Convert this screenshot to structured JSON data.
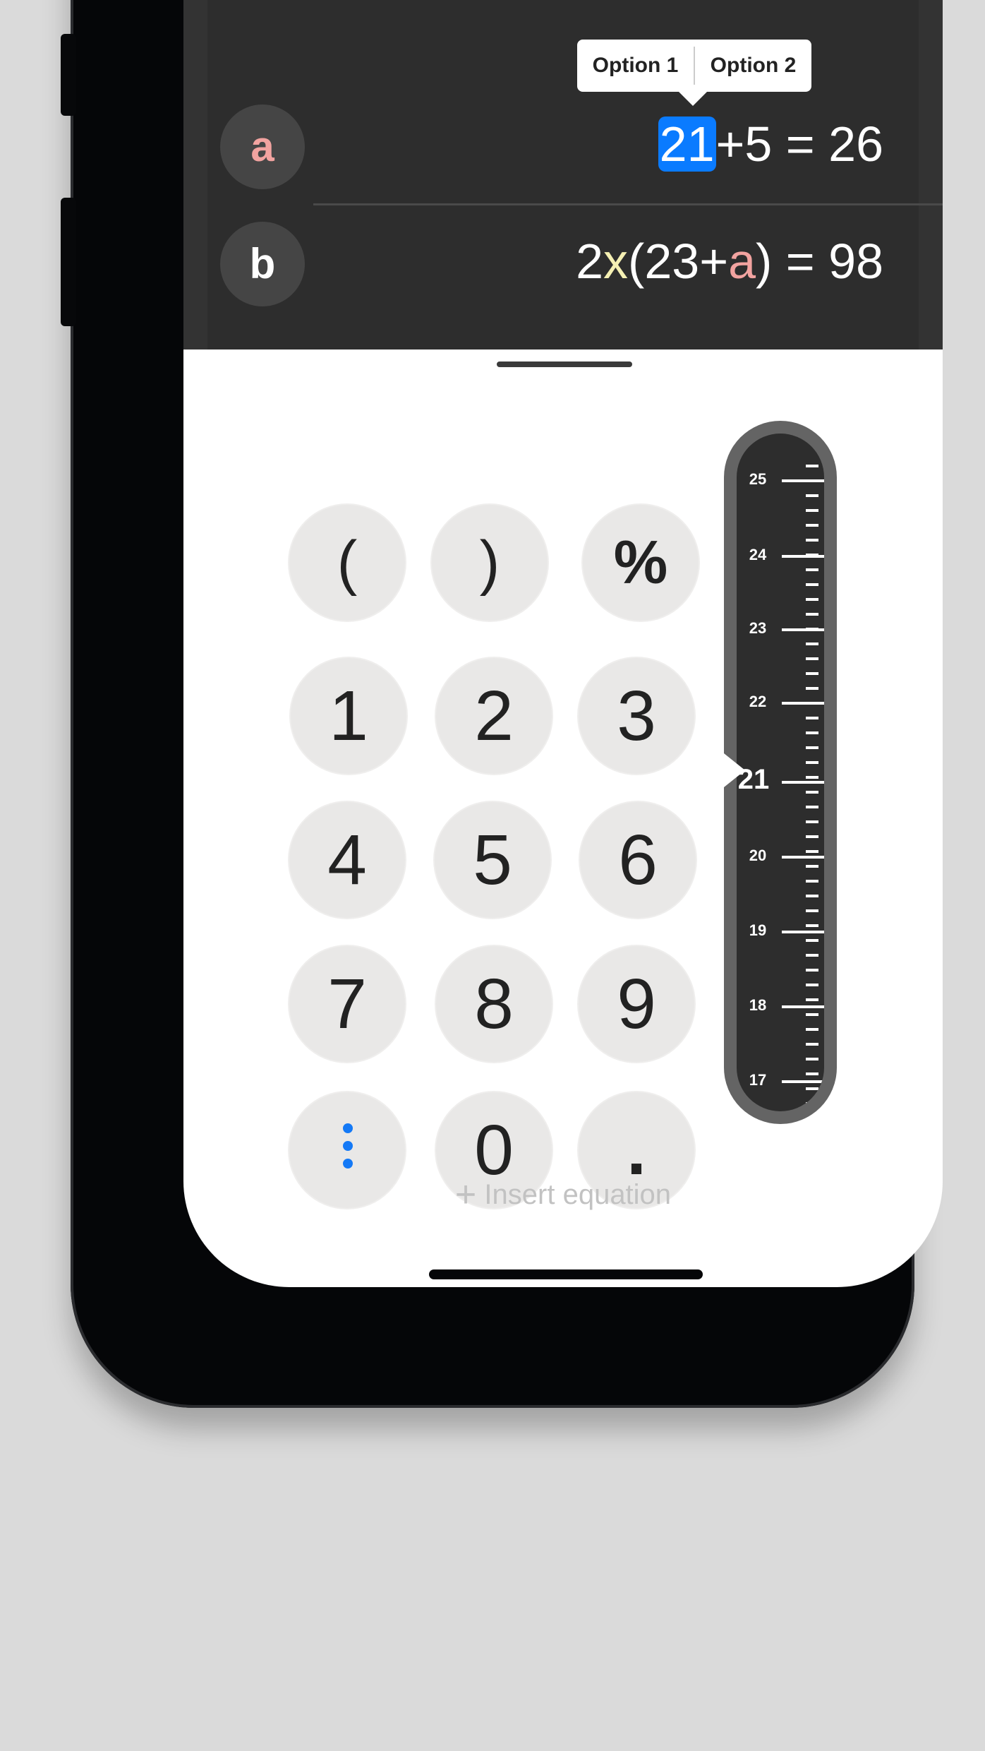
{
  "equations": [
    {
      "variable": "a",
      "variable_color": "#f2a3a0",
      "selected_token": "21",
      "rest": "+5 = 26"
    },
    {
      "variable": "b",
      "parts": {
        "p1": "2",
        "x": "x",
        "p2": "(23+",
        "a": "a",
        "p3": ") = 98"
      }
    }
  ],
  "popup": {
    "option1": "Option 1",
    "option2": "Option 2"
  },
  "keypad": {
    "row0": [
      "(",
      ")",
      "%"
    ],
    "row1": [
      "1",
      "2",
      "3"
    ],
    "row2": [
      "4",
      "5",
      "6"
    ],
    "row3": [
      "7",
      "8",
      "9"
    ],
    "row4": [
      "more-icon",
      "0",
      "."
    ]
  },
  "dial": {
    "labels": [
      "25",
      "24",
      "23",
      "22",
      "21",
      "20",
      "19",
      "18",
      "17"
    ],
    "current": 21
  },
  "insert": {
    "plus": "+",
    "label": "Insert equation"
  },
  "colors": {
    "selection": "#0a7bff",
    "x_highlight": "#f5f0b3",
    "a_highlight": "#f2a3a0",
    "accent": "#1479f6"
  }
}
